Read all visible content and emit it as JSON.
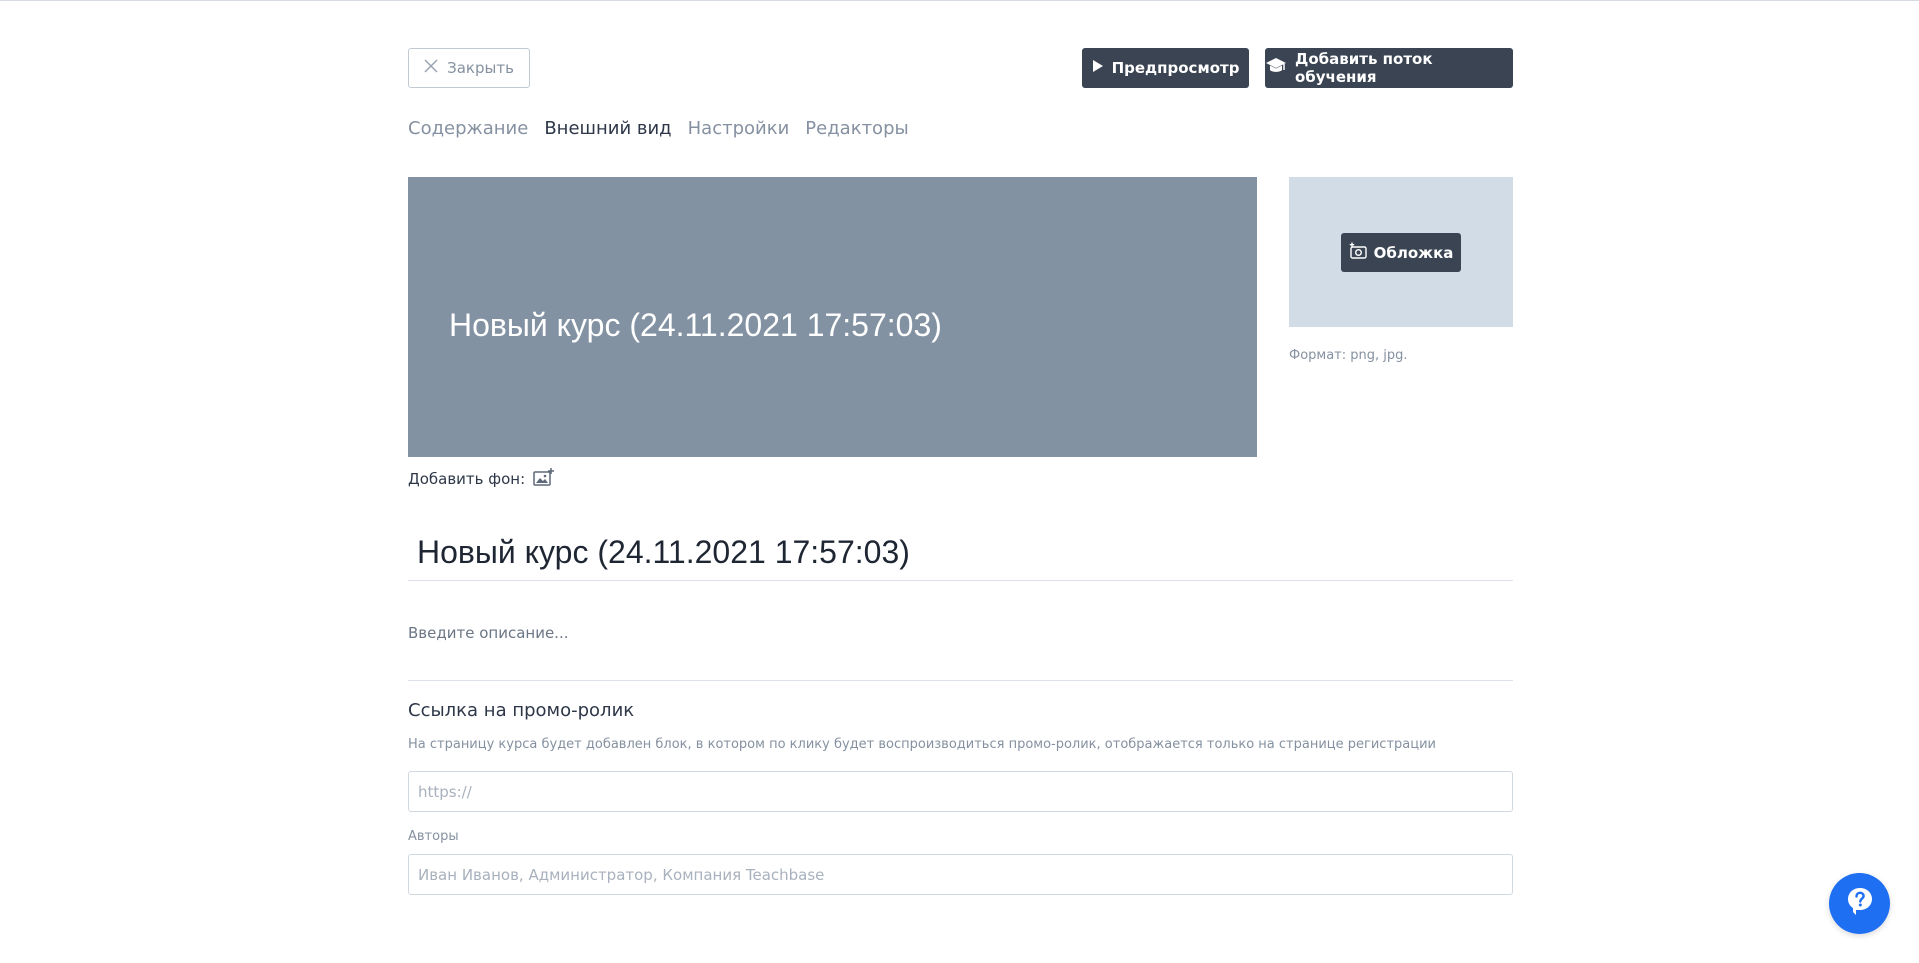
{
  "toolbar": {
    "close_label": "Закрыть",
    "preview_label": "Предпросмотр",
    "add_flow_label": "Добавить поток обучения"
  },
  "tabs": [
    {
      "label": "Содержание",
      "active": false
    },
    {
      "label": "Внешний вид",
      "active": true
    },
    {
      "label": "Настройки",
      "active": false
    },
    {
      "label": "Редакторы",
      "active": false
    }
  ],
  "hero": {
    "title": "Новый курс (24.11.2021 17:57:03)",
    "add_background_label": "Добавить фон:",
    "background_color": "#8392a3"
  },
  "cover": {
    "button_label": "Обложка",
    "format_hint": "Формат: png, jpg."
  },
  "course": {
    "title": "Новый курс (24.11.2021 17:57:03)",
    "description_placeholder": "Введите описание..."
  },
  "promo": {
    "heading": "Ссылка на промо-ролик",
    "help_text": "На страницу курса будет добавлен блок, в котором по клику будет воспроизводиться промо-ролик, отображается только на странице регистрации",
    "url_value": "",
    "url_placeholder": "https://"
  },
  "authors": {
    "label": "Авторы",
    "value": "",
    "placeholder": "Иван Иванов, Администратор, Компания Teachbase"
  },
  "icons": {
    "close": "close-icon",
    "play": "play-icon",
    "graduation": "graduation-cap-icon",
    "add_image": "add-image-icon",
    "add_photo": "add-photo-icon",
    "help": "help-question-icon"
  },
  "colors": {
    "dark_button": "#3a4452",
    "accent_blue": "#1e6ff2",
    "cover_bg": "#d1dce6"
  }
}
